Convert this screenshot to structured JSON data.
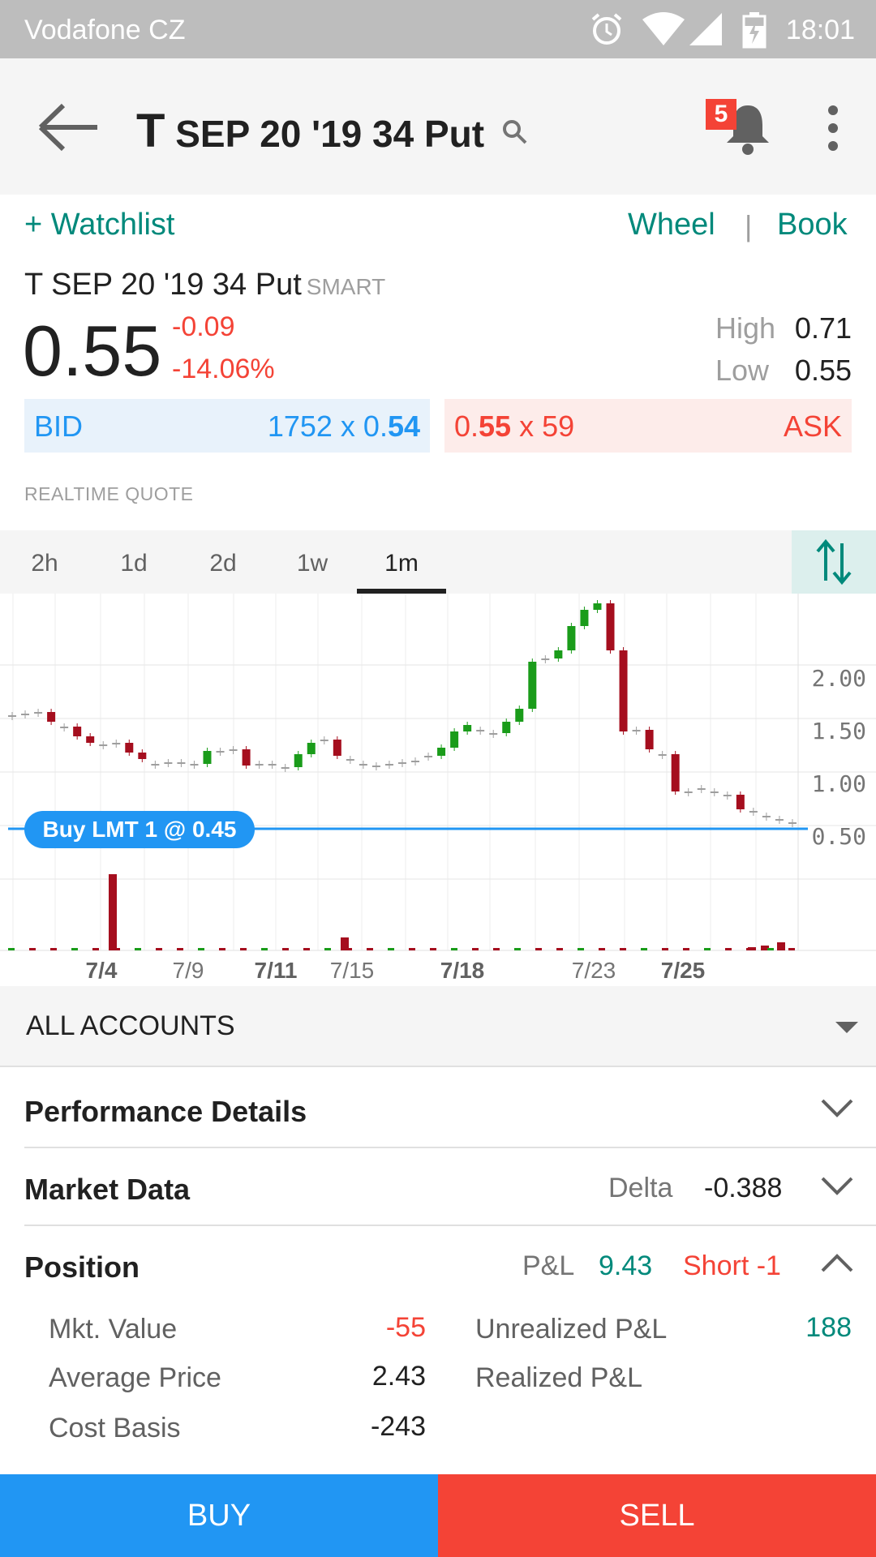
{
  "status_bar": {
    "carrier": "Vodafone CZ",
    "time": "18:01"
  },
  "header": {
    "symbol": "T",
    "title": "SEP 20 '19 34 Put",
    "notification_count": "5",
    "icons": [
      "back-arrow-icon",
      "search-icon",
      "bell-icon",
      "more-vert-icon"
    ]
  },
  "quote": {
    "watchlist_label": "+ Watchlist",
    "wheel_label": "Wheel",
    "separator": "|",
    "book_label": "Book",
    "contract_name": "T SEP 20 '19 34 Put",
    "exchange": "SMART",
    "last_price": "0.55",
    "change": "-0.09",
    "change_pct": "-14.06%",
    "high_label": "High",
    "high_value": "0.71",
    "low_label": "Low",
    "low_value": "0.55",
    "bid_label": "BID",
    "bid_size_text": "1752 x 0.",
    "bid_price_bold": "54",
    "ask_price_prefix": "0.",
    "ask_price_bold": "55",
    "ask_size_text": " x 59",
    "ask_label": "ASK",
    "realtime_label": "REALTIME QUOTE"
  },
  "range_tabs": {
    "items": [
      "2h",
      "1d",
      "2d",
      "1w",
      "1m"
    ],
    "active": "1m"
  },
  "chart_data": {
    "type": "candlestick",
    "y_tick_labels": [
      "2.00",
      "1.50",
      "1.00",
      "0.50"
    ],
    "x_tick_labels": [
      "7/4",
      "7/9",
      "7/11",
      "7/15",
      "7/18",
      "7/23",
      "7/25"
    ],
    "order_line": {
      "label": "Buy LMT 1 @ 0.45",
      "price": 0.45
    },
    "up_color": "#1a9c1a",
    "down_color": "#a50e1e",
    "order_color": "#2196f3"
  },
  "accounts": {
    "label": "ALL ACCOUNTS"
  },
  "sections": {
    "performance": "Performance Details",
    "market_data": "Market Data",
    "delta_label": "Delta",
    "delta_value": "-0.388",
    "position": "Position",
    "pnl_label": "P&L",
    "pnl_value": "9.43",
    "position_size": "Short -1"
  },
  "position_details": {
    "mkt_value_label": "Mkt. Value",
    "mkt_value": "-55",
    "avg_price_label": "Average Price",
    "avg_price": "2.43",
    "cost_basis_label": "Cost Basis",
    "cost_basis": "-243",
    "unrealized_label": "Unrealized P&L",
    "unrealized_value": "188",
    "realized_label": "Realized P&L"
  },
  "actions": {
    "buy": "BUY",
    "sell": "SELL"
  },
  "colors": {
    "accent": "#00897b",
    "negative": "#f44336",
    "bid": "#2196f3"
  }
}
